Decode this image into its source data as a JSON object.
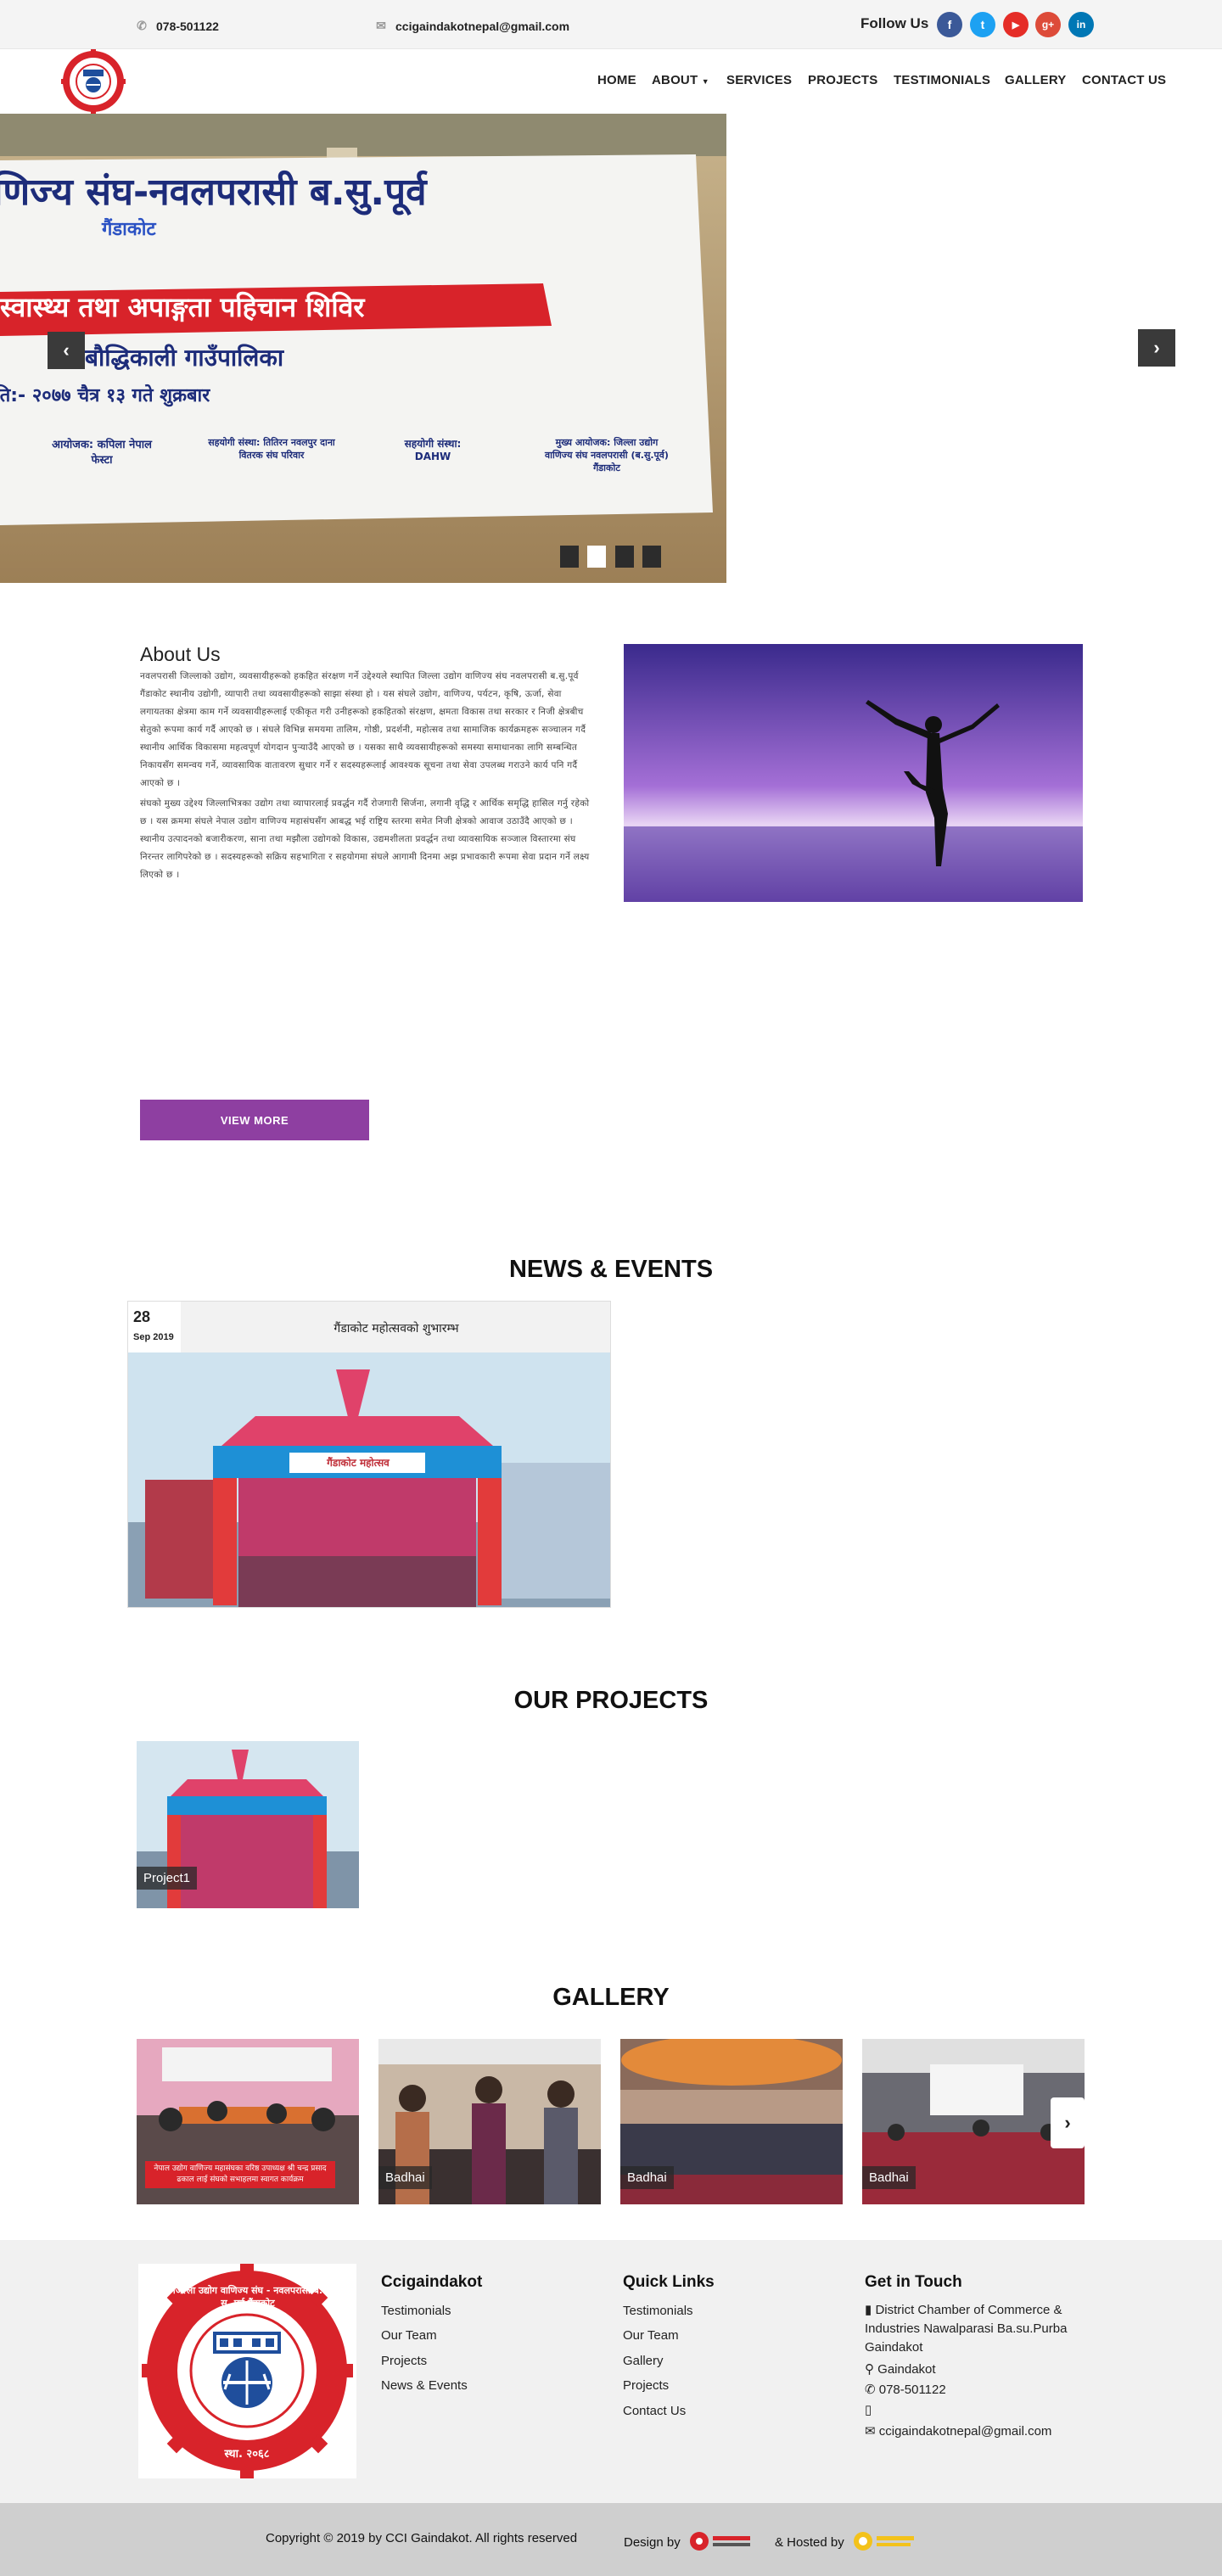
{
  "topbar": {
    "phone": "078-501122",
    "email": "ccigaindakotnepal@gmail.com",
    "follow_label": "Follow Us",
    "social": [
      {
        "icon": "facebook-icon",
        "glyph": "f",
        "color": "#3b5998"
      },
      {
        "icon": "twitter-icon",
        "glyph": "t",
        "color": "#1da1f2"
      },
      {
        "icon": "youtube-icon",
        "glyph": "▶",
        "color": "#e52d27"
      },
      {
        "icon": "google-plus-icon",
        "glyph": "g+",
        "color": "#dd4b39"
      },
      {
        "icon": "linkedin-icon",
        "glyph": "in",
        "color": "#0077b5"
      }
    ]
  },
  "nav": {
    "home": "HOME",
    "about": "ABOUT",
    "services": "SERVICES",
    "projects": "PROJECTS",
    "testimonials": "TESTIMONIALS",
    "gallery": "GALLERY",
    "contact": "CONTACT US"
  },
  "hero": {
    "banner_line1": "णिज्य संघ-नवलपरासी ब.सु.पूर्व",
    "banner_line2": "गैंडाकोट",
    "banner_line3": "स्वास्थ्य तथा अपाङ्गता पहिचान शिविर",
    "banner_line4": "बौद्धिकाली गाउँपालिका",
    "banner_line5": "ति:- २०७७ चैत्र १३ गते शुक्रबार",
    "org1": "आयोजक: कपिला नेपाल फेस्टा",
    "org2": "सहयोगी संस्था: तितिरन नवलपुर दाना वितरक संघ परिवार",
    "org3": "सहयोगी संस्था: DAHW",
    "org4": "मुख्य आयोजक: जिल्ला उद्योग वाणिज्य संघ नवलपरासी (ब.सु.पूर्व) गैंडाकोट",
    "slide_count": 4,
    "active_slide": 2
  },
  "about": {
    "title": "About Us",
    "para1": "नवलपरासी जिल्लाको उद्योग, व्यवसायीहरूको हकहित संरक्षण गर्ने उद्देश्यले स्थापित जिल्ला उद्योग वाणिज्य संघ नवलपरासी ब.सु.पूर्व गैंडाकोट स्थानीय उद्योगी, व्यापारी तथा व्यवसायीहरूको साझा संस्था हो । यस संघले उद्योग, वाणिज्य, पर्यटन, कृषि, ऊर्जा, सेवा लगायतका क्षेत्रमा काम गर्ने व्यवसायीहरूलाई एकीकृत गरी उनीहरूको हकहितको संरक्षण, क्षमता विकास तथा सरकार र निजी क्षेत्रबीच सेतुको रूपमा कार्य गर्दै आएको छ । संघले विभिन्न समयमा तालिम, गोष्ठी, प्रदर्शनी, महोत्सव तथा सामाजिक कार्यक्रमहरू सञ्चालन गर्दै स्थानीय आर्थिक विकासमा महत्वपूर्ण योगदान पुर्‍याउँदै आएको छ । यसका साथै व्यवसायीहरूको समस्या समाधानका लागि सम्बन्धित निकायसँग समन्वय गर्ने, व्यावसायिक वातावरण सुधार गर्ने र सदस्यहरूलाई आवश्यक सूचना तथा सेवा उपलब्ध गराउने कार्य पनि गर्दै आएको छ ।",
    "para2": "संघको मुख्य उद्देश्य जिल्लाभित्रका उद्योग तथा व्यापारलाई प्रवर्द्धन गर्दै रोजगारी सिर्जना, लगानी वृद्धि र आर्थिक समृद्धि हासिल गर्नु रहेको छ । यस क्रममा संघले नेपाल उद्योग वाणिज्य महासंघसँग आबद्ध भई राष्ट्रिय स्तरमा समेत निजी क्षेत्रको आवाज उठाउँदै आएको छ । स्थानीय उत्पादनको बजारीकरण, साना तथा मझौला उद्योगको विकास, उद्यमशीलता प्रवर्द्धन तथा व्यावसायिक सञ्जाल विस्तारमा संघ निरन्तर लागिपरेको छ । सदस्यहरूको सक्रिय सहभागिता र सहयोगमा संघले आगामी दिनमा अझ प्रभावकारी रूपमा सेवा प्रदान गर्ने लक्ष्य लिएको छ ।",
    "view_more": "VIEW MORE"
  },
  "news": {
    "section_title": "NEWS & EVENTS",
    "items": [
      {
        "day": "28",
        "month": "Sep 2019",
        "title": "गैंडाकोट महोत्सवको शुभारम्भ"
      }
    ],
    "stage_text": "गैंडाकोट महोत्सव"
  },
  "projects": {
    "section_title": "OUR PROJECTS",
    "items": [
      {
        "caption": "Project1"
      }
    ]
  },
  "gallery": {
    "section_title": "GALLERY",
    "items": [
      {
        "caption": "नेपाल उद्योग वाणिज्य महासंघका वरिष्ठ उपाध्यक्ष श्री चन्द्र प्रसाद ढकाल लाई संघको सभाहलमा स्वागत कार्यक्रम"
      },
      {
        "caption": "Badhai"
      },
      {
        "caption": "Badhai"
      },
      {
        "caption": "Badhai"
      }
    ]
  },
  "footer": {
    "col1_title": "Ccigaindakot",
    "col1_links": [
      "Testimonials",
      "Our Team",
      "Projects",
      "News & Events"
    ],
    "col2_title": "Quick Links",
    "col2_links": [
      "Testimonials",
      "Our Team",
      "Gallery",
      "Projects",
      "Contact Us"
    ],
    "col3_title": "Get in Touch",
    "address": "District Chamber of Commerce & Industries Nawalparasi Ba.su.Purba Gaindakot",
    "city": "Gaindakot",
    "phone": "078-501122",
    "mobile": "",
    "email": "ccigaindakotnepal@gmail.com",
    "copyright": "Copyright © 2019 by CCI Gaindakot. All rights reserved",
    "design_by": "Design by",
    "hosted_by": "& Hosted by",
    "logo_text": "जिल्ला उद्योग वाणिज्य संघ - नवलपरासी ब. सु. पूर्व  गैंडाकोट",
    "logo_est": "स्था. २०६८"
  },
  "colors": {
    "accent": "#8e3fa1",
    "topbar_bg": "#f4f4f4",
    "footer_bg": "#f1f1f1",
    "bottom_bg": "#cfcfcf"
  }
}
